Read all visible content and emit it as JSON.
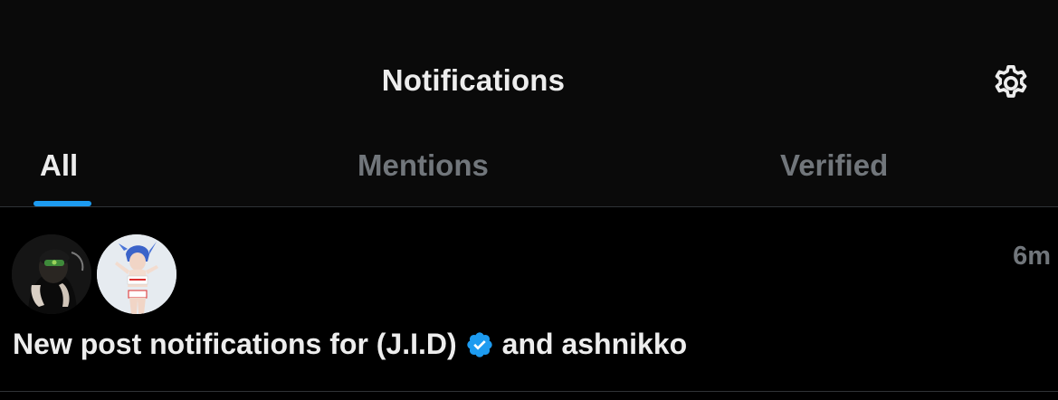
{
  "header": {
    "title": "Notifications",
    "settings_icon": "gear-icon"
  },
  "tabs": [
    {
      "label": "All",
      "active": true
    },
    {
      "label": "Mentions",
      "active": false
    },
    {
      "label": "Verified",
      "active": false
    }
  ],
  "notification": {
    "avatars": [
      "avatar-jid",
      "avatar-ashnikko"
    ],
    "timestamp": "6m",
    "text_prefix": "New post notifications for",
    "user1": "(J.I.D)",
    "verified_icon": "verified-badge-icon",
    "text_suffix": "and ashnikko"
  },
  "colors": {
    "accent": "#1d9bf0",
    "text_primary": "#ededed",
    "text_secondary": "#71767b",
    "background": "#000000"
  }
}
